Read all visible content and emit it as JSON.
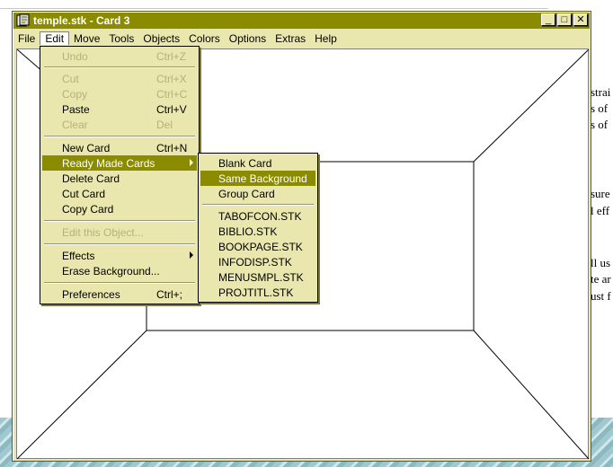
{
  "window": {
    "title": "temple.stk - Card 3",
    "minimize": "_",
    "restore": "□",
    "close": "✕"
  },
  "menubar": {
    "items": [
      "File",
      "Edit",
      "Move",
      "Tools",
      "Objects",
      "Colors",
      "Options",
      "Extras",
      "Help"
    ]
  },
  "edit_menu": {
    "undo": {
      "label": "Undo",
      "shortcut": "Ctrl+Z"
    },
    "cut": {
      "label": "Cut",
      "shortcut": "Ctrl+X"
    },
    "copy": {
      "label": "Copy",
      "shortcut": "Ctrl+C"
    },
    "paste": {
      "label": "Paste",
      "shortcut": "Ctrl+V"
    },
    "clear": {
      "label": "Clear",
      "shortcut": "Del"
    },
    "new_card": {
      "label": "New Card",
      "shortcut": "Ctrl+N"
    },
    "ready_made_cards": {
      "label": "Ready Made Cards"
    },
    "delete_card": {
      "label": "Delete Card"
    },
    "cut_card": {
      "label": "Cut Card"
    },
    "copy_card": {
      "label": "Copy Card"
    },
    "edit_object": {
      "label": "Edit this Object..."
    },
    "effects": {
      "label": "Effects"
    },
    "erase_background": {
      "label": "Erase Background..."
    },
    "preferences": {
      "label": "Preferences",
      "shortcut": "Ctrl+;"
    }
  },
  "submenu": {
    "blank_card": "Blank Card",
    "same_background": "Same Background",
    "group_card": "Group Card",
    "files": [
      "TABOFCON.STK",
      "BIBLIO.STK",
      "BOOKPAGE.STK",
      "INFODISP.STK",
      "MENUSMPL.STK",
      "PROJTITL.STK"
    ]
  },
  "background_doc": {
    "fragments": [
      "strai",
      "s of",
      "s of",
      "sure",
      "l eff",
      "ll us",
      "te ar",
      "ust f"
    ]
  },
  "colors": {
    "titlebar": "#8b8b00",
    "menu_bg": "#e9e7ad",
    "highlight": "#8b8b00",
    "disabled": "#b4b27a"
  }
}
